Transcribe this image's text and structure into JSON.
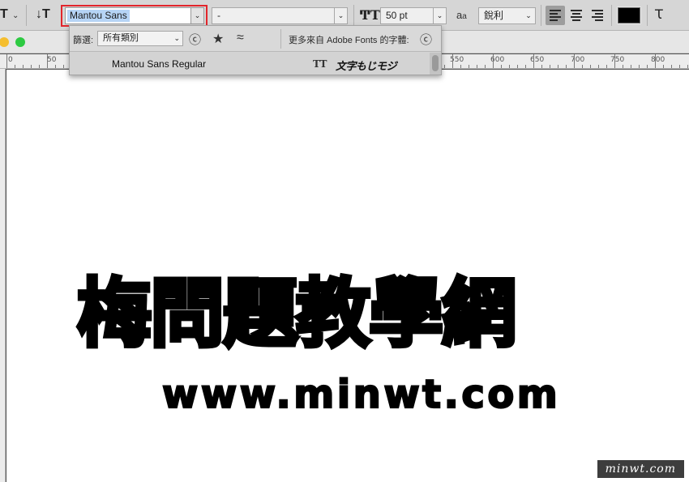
{
  "options_bar": {
    "tool_preset_icon": "type-tool-icon",
    "orientation_icon": "text-orientation-icon",
    "font_family": "Mantou Sans",
    "font_style": "-",
    "font_size_icon": "font-size-icon",
    "font_size": "50 pt",
    "antialias_icon": "antialias-icon",
    "antialias": "銳利",
    "align_left_active": true,
    "text_color": "#000000",
    "warp_icon": "warp-text-icon"
  },
  "font_panel": {
    "filter_label": "篩選:",
    "filter_value": "所有類別",
    "cc_icon": "creative-cloud-icon",
    "favorite_icon": "star-icon",
    "similar_icon": "similar-fonts-icon",
    "more_from_label": "更多來自 Adobe Fonts 的字體:",
    "font_item_name": "Mantou Sans Regular",
    "font_item_type_icon": "truetype-icon",
    "font_item_sample": "文字もじモジ"
  },
  "ruler": {
    "labels": [
      "0",
      "50",
      "550",
      "600",
      "650",
      "700",
      "750",
      "800"
    ]
  },
  "canvas": {
    "headline": "梅問題教學網",
    "url_text": "www.minwt.com",
    "watermark": "minwt.com"
  },
  "colors": {
    "highlight_box": "#e2252b",
    "selection": "#b6d4f5",
    "traffic_light_yellow": "#f5be2f",
    "traffic_light_green": "#2dca42"
  }
}
